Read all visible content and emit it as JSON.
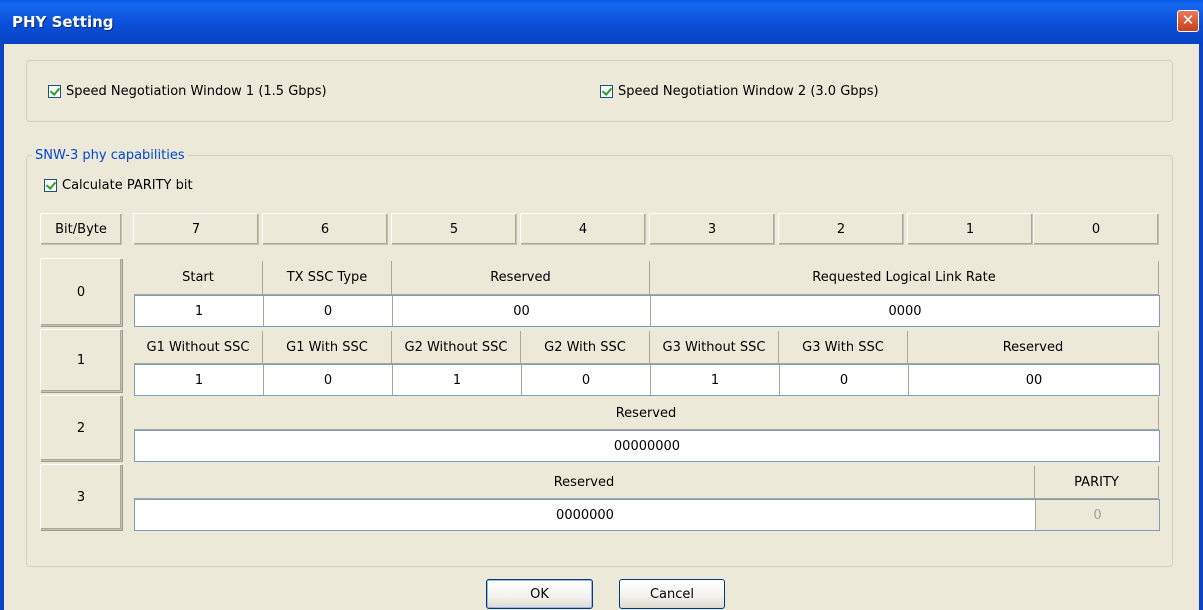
{
  "window": {
    "title": "PHY Setting",
    "close_glyph": "✕"
  },
  "speed": {
    "snw1_label": "Speed Negotiation Window 1 (1.5 Gbps)",
    "snw2_label": "Speed Negotiation Window 2 (3.0 Gbps)",
    "snw1_checked": true,
    "snw2_checked": true
  },
  "snw3": {
    "legend": "SNW-3 phy capabilities",
    "parity_check_label": "Calculate PARITY bit",
    "parity_checked": true,
    "corner_header": "Bit/Byte",
    "bit_headers": [
      "7",
      "6",
      "5",
      "4",
      "3",
      "2",
      "1",
      "0"
    ],
    "rows": [
      {
        "byte": "0",
        "fields": [
          {
            "label": "Start",
            "value": "1"
          },
          {
            "label": "TX SSC Type",
            "value": "0"
          },
          {
            "label": "Reserved",
            "value": "00"
          },
          {
            "label": "Requested Logical Link Rate",
            "value": "0000"
          }
        ]
      },
      {
        "byte": "1",
        "fields": [
          {
            "label": "G1 Without SSC",
            "value": "1"
          },
          {
            "label": "G1 With SSC",
            "value": "0"
          },
          {
            "label": "G2 Without SSC",
            "value": "1"
          },
          {
            "label": "G2 With SSC",
            "value": "0"
          },
          {
            "label": "G3 Without SSC",
            "value": "1"
          },
          {
            "label": "G3 With SSC",
            "value": "0"
          },
          {
            "label": "Reserved",
            "value": "00"
          }
        ]
      },
      {
        "byte": "2",
        "fields": [
          {
            "label": "Reserved",
            "value": "00000000"
          }
        ]
      },
      {
        "byte": "3",
        "fields": [
          {
            "label": "Reserved",
            "value": "0000000"
          },
          {
            "label": "PARITY",
            "value": "0",
            "disabled": true
          }
        ]
      }
    ]
  },
  "buttons": {
    "ok": "OK",
    "cancel": "Cancel"
  },
  "colors": {
    "titlebar": "#0a4fd8",
    "legend_text": "#0046d5",
    "dialog_bg": "#ece9d8",
    "check_mark": "#21a121"
  }
}
